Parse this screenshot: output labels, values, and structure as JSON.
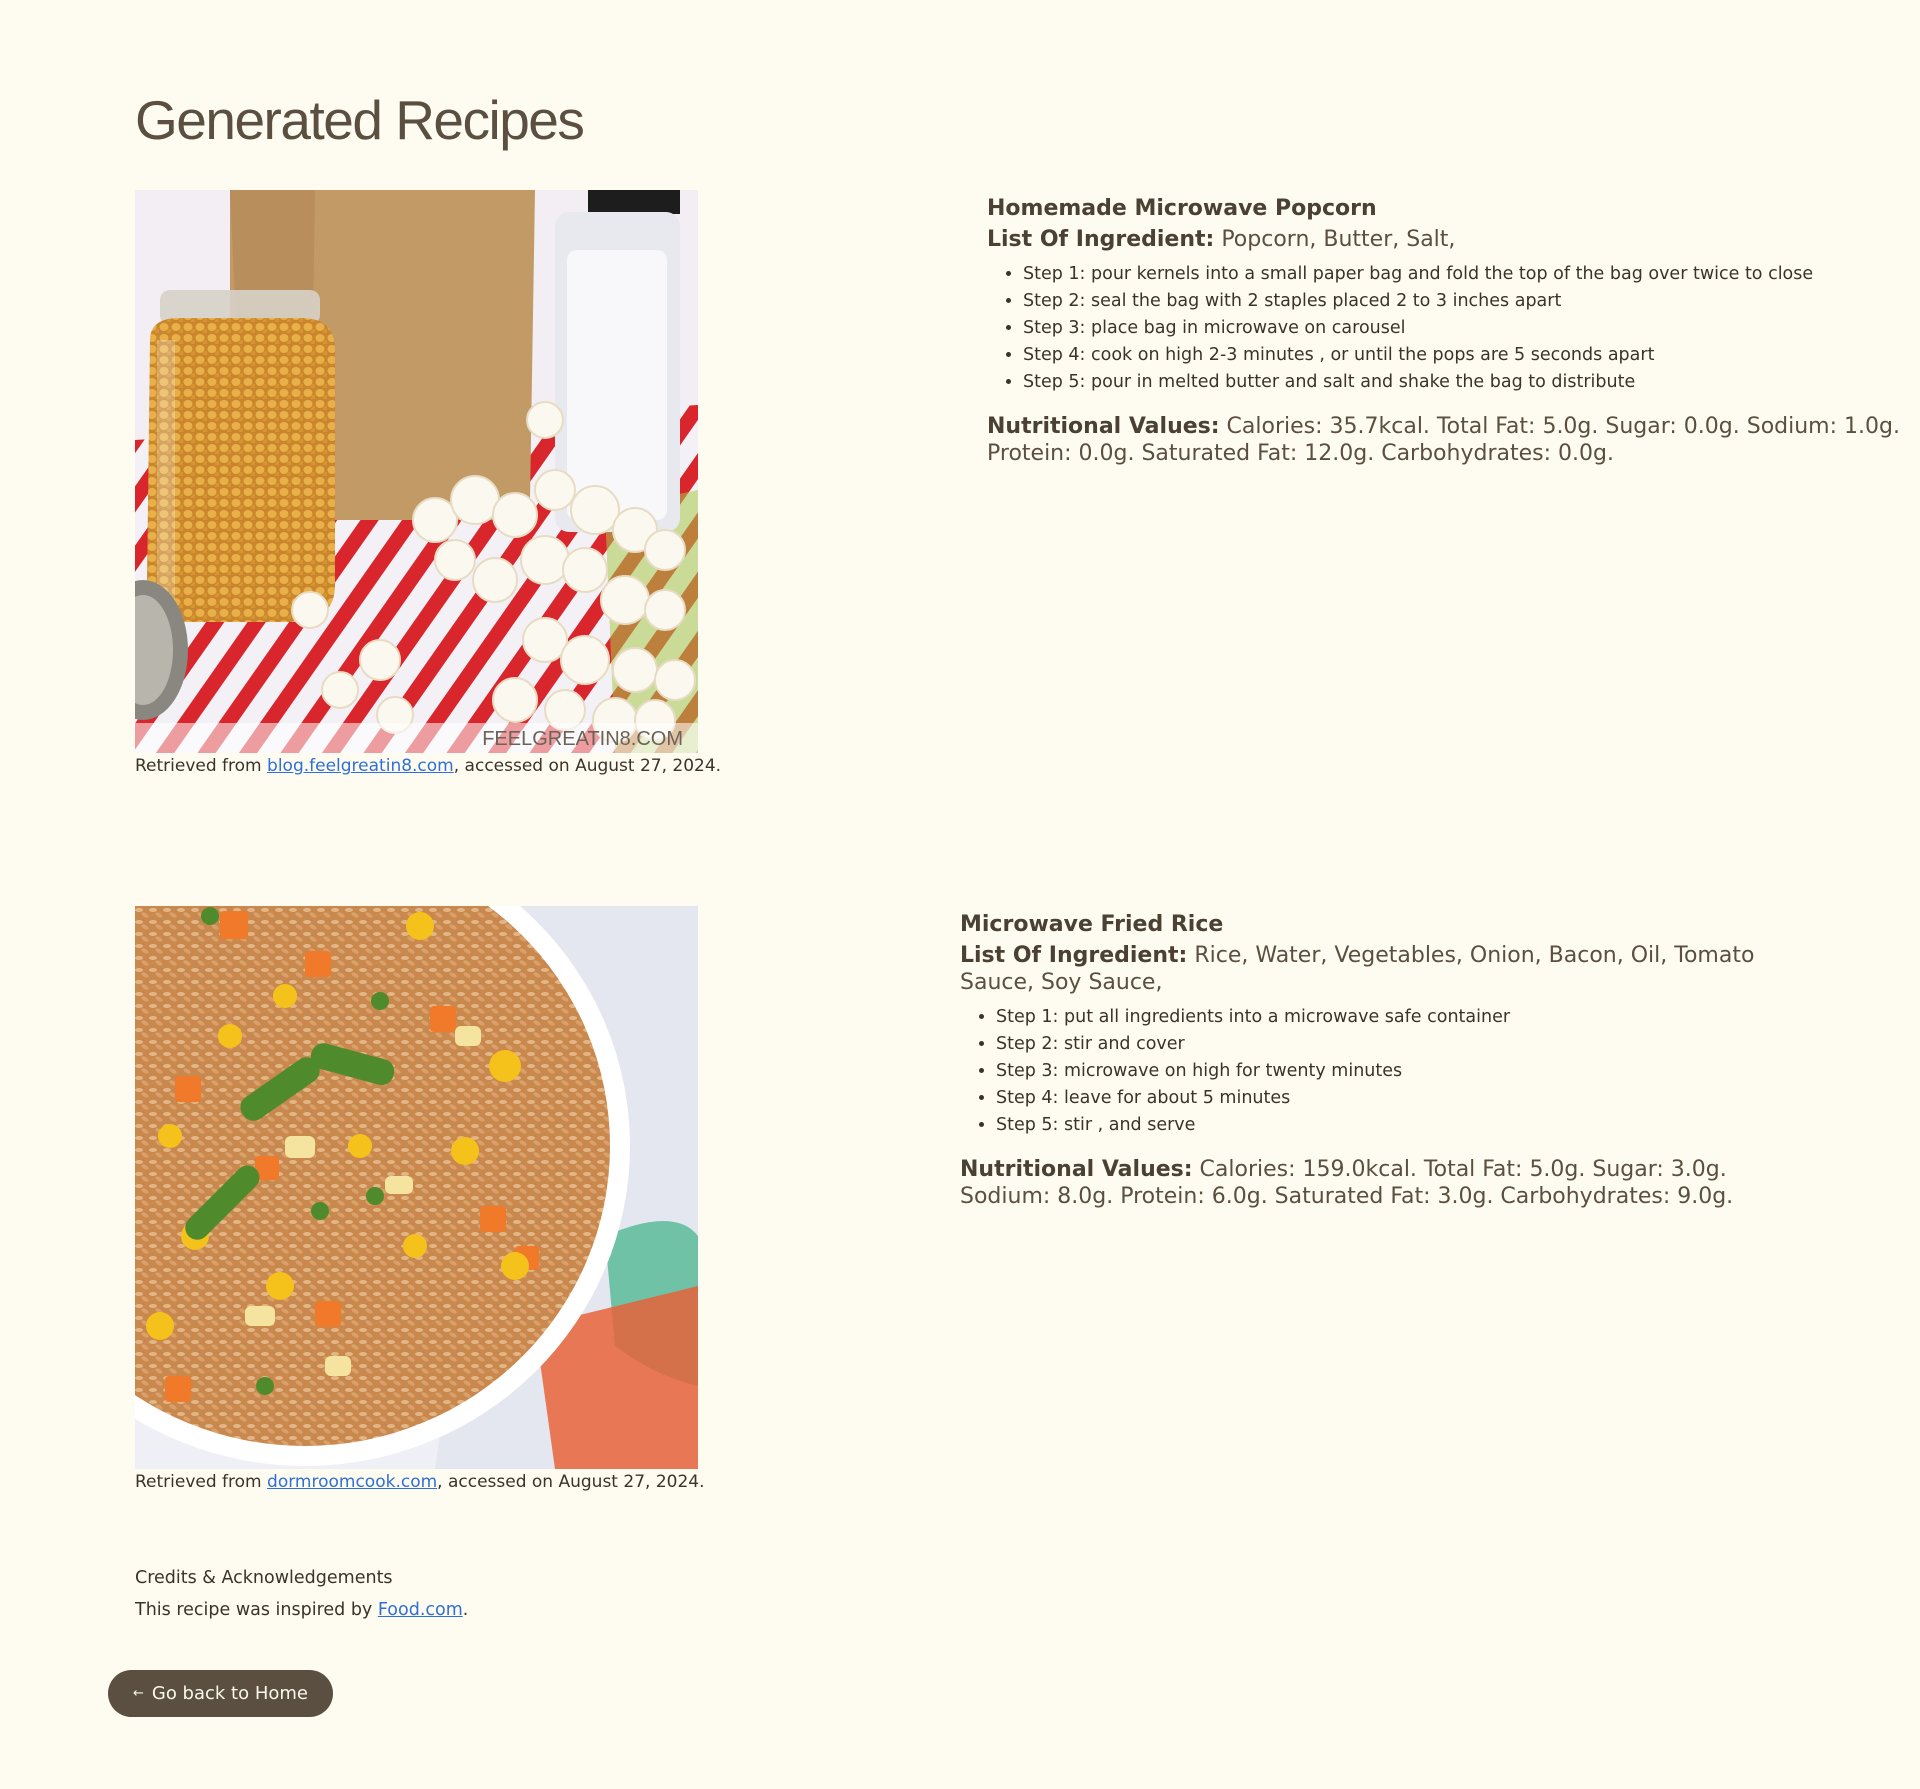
{
  "page": {
    "title": "Generated Recipes"
  },
  "recipes": [
    {
      "name": "Homemade Microwave Popcorn",
      "ingredients_label": "List Of Ingredient:",
      "ingredients": "Popcorn, Butter, Salt,",
      "steps": [
        "Step 1: pour kernels into a small paper bag and fold the top of the bag over twice to close",
        "Step 2: seal the bag with 2 staples placed 2 to 3 inches apart",
        "Step 3: place bag in microwave on carousel",
        "Step 4: cook on high 2-3 minutes , or until the pops are 5 seconds apart",
        "Step 5: pour in melted butter and salt and shake the bag to distribute"
      ],
      "nutrition_label": "Nutritional Values:",
      "nutrition": "Calories: 35.7kcal. Total Fat: 5.0g. Sugar: 0.0g. Sodium: 1.0g. Protein: 0.0g. Saturated Fat: 12.0g. Carbohydrates: 0.0g.",
      "image_watermark": "FEELGREATIN8.COM",
      "caption_prefix": "Retrieved from ",
      "caption_link": "blog.feelgreatin8.com",
      "caption_suffix": ", accessed on August 27, 2024."
    },
    {
      "name": "Microwave Fried Rice",
      "ingredients_label": "List Of Ingredient:",
      "ingredients": "Rice, Water, Vegetables, Onion, Bacon, Oil, Tomato Sauce, Soy Sauce,",
      "steps": [
        "Step 1: put all ingredients into a microwave safe container",
        "Step 2: stir and cover",
        "Step 3: microwave on high for twenty minutes",
        "Step 4: leave for about 5 minutes",
        "Step 5: stir , and serve"
      ],
      "nutrition_label": "Nutritional Values:",
      "nutrition": "Calories: 159.0kcal. Total Fat: 5.0g. Sugar: 3.0g. Sodium: 8.0g. Protein: 6.0g. Saturated Fat: 3.0g. Carbohydrates: 9.0g.",
      "caption_prefix": "Retrieved from ",
      "caption_link": "dormroomcook.com",
      "caption_suffix": ", accessed on August 27, 2024."
    }
  ],
  "credits": {
    "title": "Credits & Acknowledgements",
    "text_prefix": "This recipe was inspired by ",
    "link": "Food.com",
    "text_suffix": "."
  },
  "home_button": {
    "arrow": "←",
    "label": "Go back to Home"
  },
  "colors": {
    "background": "#fefcf0",
    "text": "#3b3328",
    "button": "#5a4f40",
    "link": "#2f6fd6"
  }
}
